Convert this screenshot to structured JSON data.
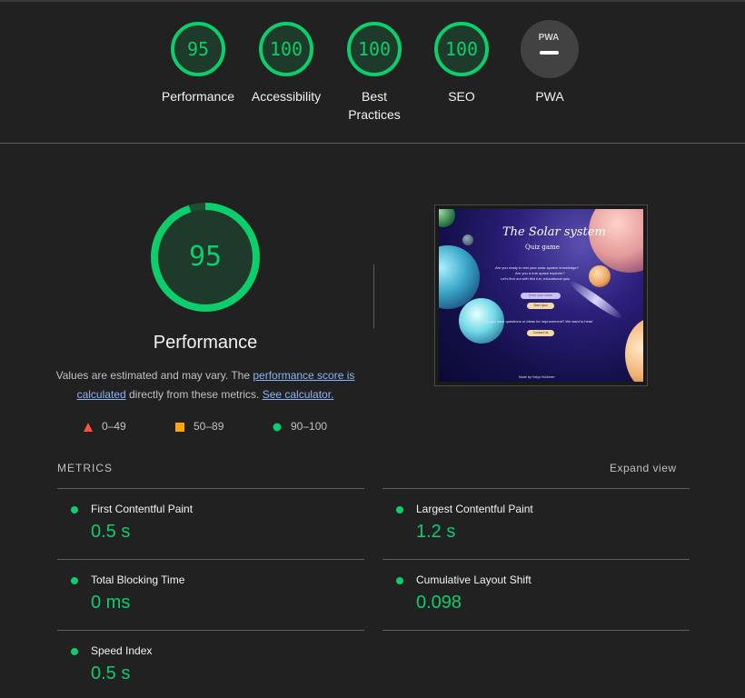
{
  "colors": {
    "pass": "#0cce6b",
    "average": "#ffa400",
    "fail": "#ff4e42",
    "neutral": "#9e9e9e",
    "link": "#8ab4f8"
  },
  "gauges": [
    {
      "score": "95",
      "label": "Performance"
    },
    {
      "score": "100",
      "label": "Accessibility"
    },
    {
      "score": "100",
      "label": "Best Practices"
    },
    {
      "score": "100",
      "label": "SEO"
    },
    {
      "badge": "PWA",
      "label": "PWA",
      "icon": "pwa-dash-icon"
    }
  ],
  "performance": {
    "score": "95",
    "score_fraction": 0.95,
    "title": "Performance",
    "desc_prefix": "Values are estimated and may vary. The ",
    "desc_link1": "performance score is calculated",
    "desc_middle": " directly from these metrics. ",
    "desc_link2": "See calculator."
  },
  "legend": [
    {
      "icon": "triangle-fail-icon",
      "label": "0–49"
    },
    {
      "icon": "square-average-icon",
      "label": "50–89"
    },
    {
      "icon": "circle-pass-icon",
      "label": "90–100"
    }
  ],
  "thumbnail": {
    "title": "The Solar system",
    "subtitle": "Quiz game",
    "lines": [
      "Are you ready to test your solar system knowledge?",
      "Are you a true space explorer?",
      "Let's find out with this fun, educational quiz."
    ],
    "input_placeholder": "Enter your name",
    "start_button": "Start Quiz",
    "feedback_text": "Do you have questions or ideas for improvement? We want to hear!",
    "contact_button": "Contact us",
    "footer": "Made by Hiviya Hukkinen"
  },
  "metrics": {
    "heading": "METRICS",
    "expand_label": "Expand view",
    "items": [
      {
        "name": "First Contentful Paint",
        "value": "0.5 s"
      },
      {
        "name": "Largest Contentful Paint",
        "value": "1.2 s"
      },
      {
        "name": "Total Blocking Time",
        "value": "0 ms"
      },
      {
        "name": "Cumulative Layout Shift",
        "value": "0.098"
      },
      {
        "name": "Speed Index",
        "value": "0.5 s"
      }
    ]
  }
}
